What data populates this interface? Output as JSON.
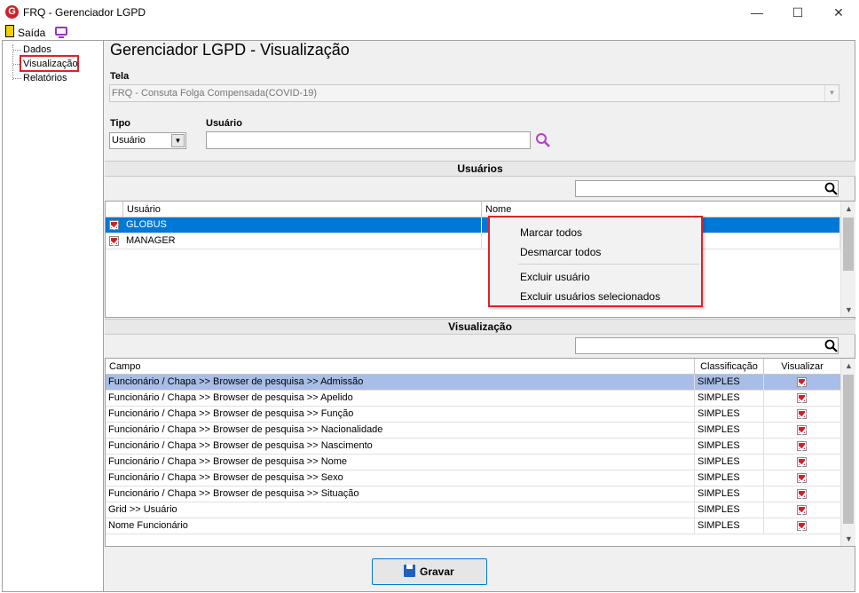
{
  "window": {
    "title": "FRQ - Gerenciador LGPD",
    "logo": "G",
    "minimize": "—",
    "maximize": "☐",
    "close": "✕"
  },
  "toolbar": {
    "exit_label": "Saída"
  },
  "tree": {
    "items": [
      {
        "label": "Dados"
      },
      {
        "label": "Visualização"
      },
      {
        "label": "Relatórios"
      }
    ]
  },
  "main": {
    "title": "Gerenciador LGPD - Visualização",
    "tela_label": "Tela",
    "tela_value": "FRQ - Consuta Folga Compensada(COVID-19)",
    "tipo_label": "Tipo",
    "tipo_value": "Usuário",
    "usuario_label": "Usuário",
    "usuario_value": ""
  },
  "users_section": {
    "header": "Usuários",
    "search_value": "",
    "columns": [
      "Usuário",
      "Nome"
    ],
    "rows": [
      {
        "checked": true,
        "usuario": "GLOBUS",
        "nome": "",
        "selected": true
      },
      {
        "checked": true,
        "usuario": "MANAGER",
        "nome": "",
        "selected": false
      }
    ]
  },
  "context_menu": {
    "items": [
      "Marcar todos",
      "Desmarcar todos",
      "Excluir usuário",
      "Excluir usuários selecionados"
    ]
  },
  "view_section": {
    "header": "Visualização",
    "search_value": "",
    "columns": [
      "Campo",
      "Classificação",
      "Visualizar"
    ],
    "rows": [
      {
        "campo": "Funcionário / Chapa >> Browser de pesquisa >> Admissão",
        "classificacao": "SIMPLES",
        "visualizar": true
      },
      {
        "campo": "Funcionário / Chapa >> Browser de pesquisa >> Apelido",
        "classificacao": "SIMPLES",
        "visualizar": true
      },
      {
        "campo": "Funcionário / Chapa >> Browser de pesquisa >> Função",
        "classificacao": "SIMPLES",
        "visualizar": true
      },
      {
        "campo": "Funcionário / Chapa >> Browser de pesquisa >> Nacionalidade",
        "classificacao": "SIMPLES",
        "visualizar": true
      },
      {
        "campo": "Funcionário / Chapa >> Browser de pesquisa >> Nascimento",
        "classificacao": "SIMPLES",
        "visualizar": true
      },
      {
        "campo": "Funcionário / Chapa >> Browser de pesquisa >> Nome",
        "classificacao": "SIMPLES",
        "visualizar": true
      },
      {
        "campo": "Funcionário / Chapa >> Browser de pesquisa >> Sexo",
        "classificacao": "SIMPLES",
        "visualizar": true
      },
      {
        "campo": "Funcionário / Chapa >> Browser de pesquisa >> Situação",
        "classificacao": "SIMPLES",
        "visualizar": true
      },
      {
        "campo": "Grid >> Usuário",
        "classificacao": "SIMPLES",
        "visualizar": true
      },
      {
        "campo": "Nome Funcionário",
        "classificacao": "SIMPLES",
        "visualizar": true
      }
    ]
  },
  "footer": {
    "save_label": "Gravar"
  },
  "colors": {
    "accent_red": "#e0202a",
    "selection_blue": "#0078d7",
    "selection_row_view": "#a8bde8"
  }
}
